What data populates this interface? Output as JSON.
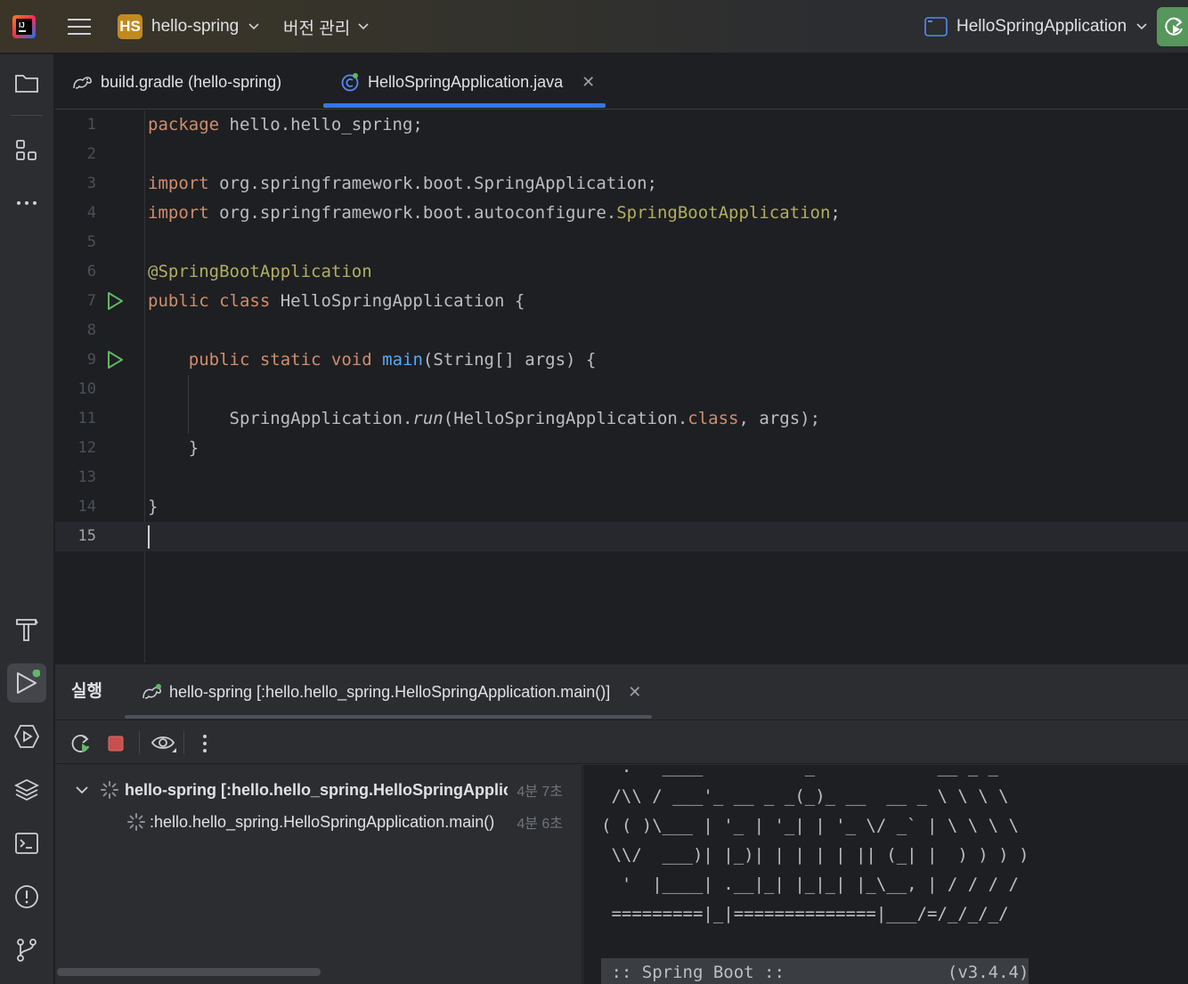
{
  "titlebar": {
    "project_badge": "HS",
    "project_name": "hello-spring",
    "vcs_label": "버전 관리",
    "run_config": "HelloSpringApplication"
  },
  "tabs": [
    {
      "label": "build.gradle (hello-spring)",
      "active": false
    },
    {
      "label": "HelloSpringApplication.java",
      "active": true
    }
  ],
  "editor": {
    "line_numbers": [
      "1",
      "2",
      "3",
      "4",
      "5",
      "6",
      "7",
      "8",
      "9",
      "10",
      "11",
      "12",
      "13",
      "14",
      "15"
    ],
    "lines": {
      "l1_kw": "package",
      "l1_rest": " hello.hello_spring;",
      "l3_kw": "import",
      "l3_rest": " org.springframework.boot.SpringApplication;",
      "l4_kw": "import",
      "l4_rest": " org.springframework.boot.autoconfigure.",
      "l4_ann": "SpringBootApplication",
      "l4_end": ";",
      "l6_ann": "@SpringBootApplication",
      "l7_kw": "public class",
      "l7_rest": " HelloSpringApplication {",
      "l9_indent": "    ",
      "l9_kw": "public static void",
      "l9_sp": " ",
      "l9_fn": "main",
      "l9_rest": "(String[] args) {",
      "l11_a": "        SpringApplication.",
      "l11_it": "run",
      "l11_b": "(HelloSpringApplication.",
      "l11_kw": "class",
      "l11_c": ", args);",
      "l12": "    }",
      "l14": "}"
    }
  },
  "run_panel": {
    "title": "실행",
    "tab_label": "hello-spring [:hello.hello_spring.HelloSpringApplication.main()]",
    "tree": [
      {
        "label": "hello-spring [:hello.hello_spring.HelloSpringApplic",
        "time": "4분 7초"
      },
      {
        "label": ":hello.hello_spring.HelloSpringApplication.main()",
        "time": "4분 6초"
      }
    ],
    "console": [
      "  .   ____          _            __ _ _",
      " /\\\\ / ___'_ __ _ _(_)_ __  __ _ \\ \\ \\ \\",
      "( ( )\\___ | '_ | '_| | '_ \\/ _` | \\ \\ \\ \\",
      " \\\\/  ___)| |_)| | | | | || (_| |  ) ) ) )",
      "  '  |____| .__|_| |_|_| |_\\__, | / / / /",
      " =========|_|==============|___/=/_/_/_/",
      "",
      " :: Spring Boot ::                (v3.4.4)"
    ]
  },
  "colors": {
    "accent": "#3574f0",
    "keyword": "#cf8e6d",
    "annotation": "#b3ae60",
    "function": "#56a8f5",
    "run_green": "#57965c"
  }
}
